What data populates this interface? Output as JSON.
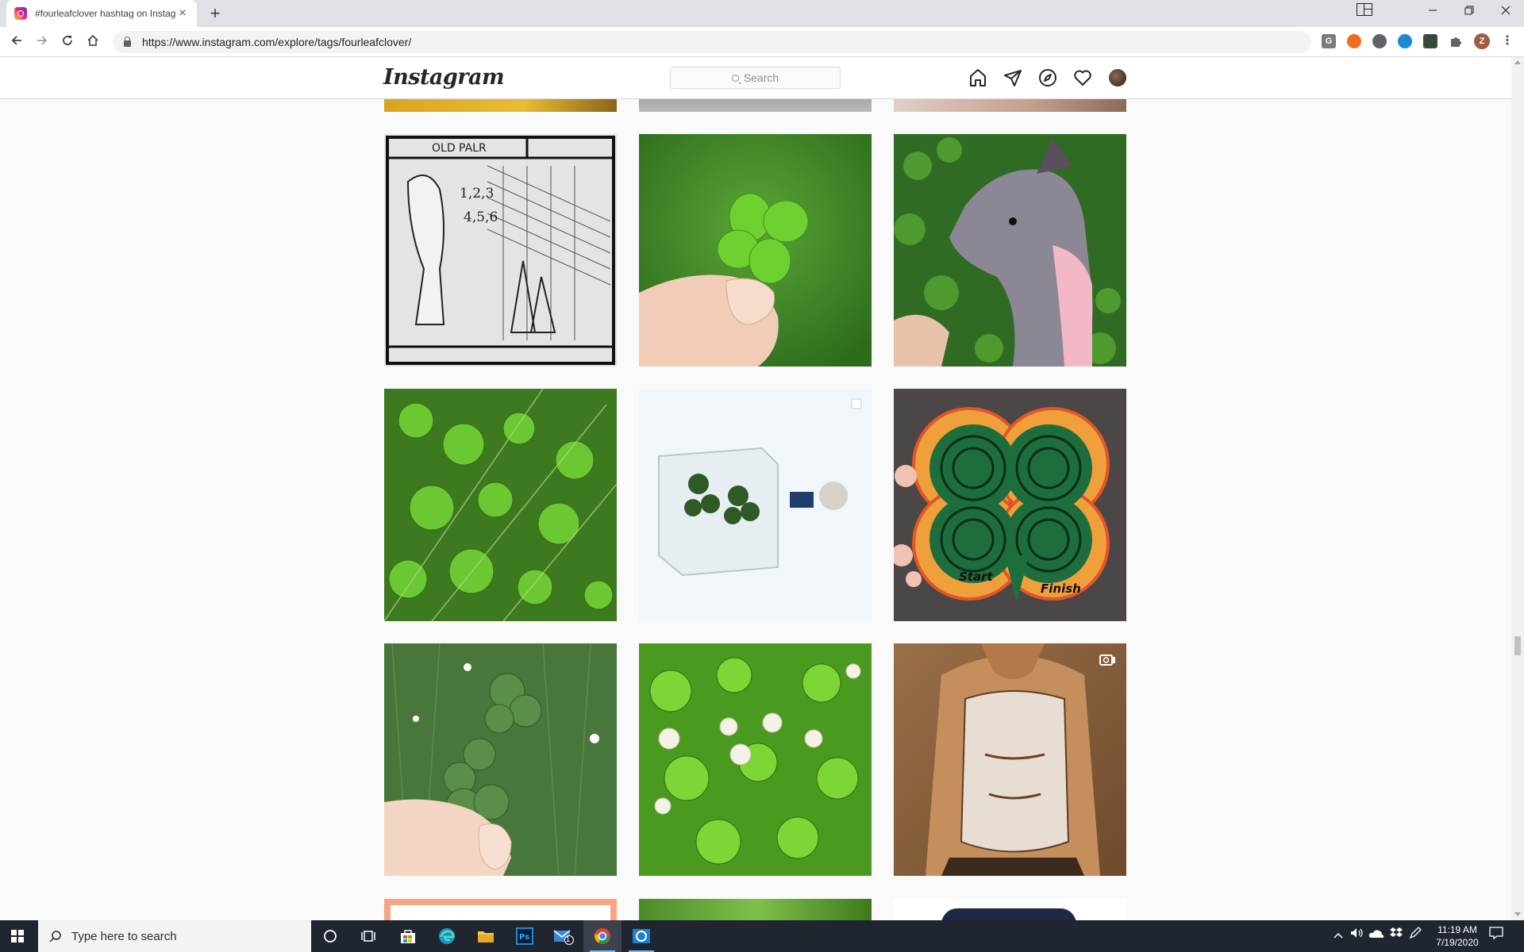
{
  "browser": {
    "tab_title": "#fourleafclover hashtag on Instag",
    "tab_close": "×",
    "new_tab": "+",
    "url": "https://www.instagram.com/explore/tags/fourleafclover/",
    "profile_initial": "Z"
  },
  "instagram": {
    "logo": "Instagram",
    "search_placeholder": "Search"
  },
  "grid": {
    "posts": [
      {
        "subject": "sketch-comic"
      },
      {
        "subject": "four-leaf-clover-in-hand"
      },
      {
        "subject": "dog-in-clover"
      },
      {
        "subject": "clover-patch"
      },
      {
        "subject": "clover-in-glass-cube",
        "badge": "carousel"
      },
      {
        "subject": "clover-maze-puzzle",
        "maze_labels": [
          "Start",
          "Finish"
        ]
      },
      {
        "subject": "clover-in-hand-grass"
      },
      {
        "subject": "clover-flowers"
      },
      {
        "subject": "anime-character",
        "badge": "video"
      }
    ]
  },
  "taskbar": {
    "search_placeholder": "Type here to search",
    "mail_badge": "1",
    "time": "11:19 AM",
    "date": "7/19/2020"
  },
  "colors": {
    "instagram_bg": "#fafafa",
    "taskbar_bg": "#1f2630",
    "tab_strip": "#dee1e6"
  }
}
